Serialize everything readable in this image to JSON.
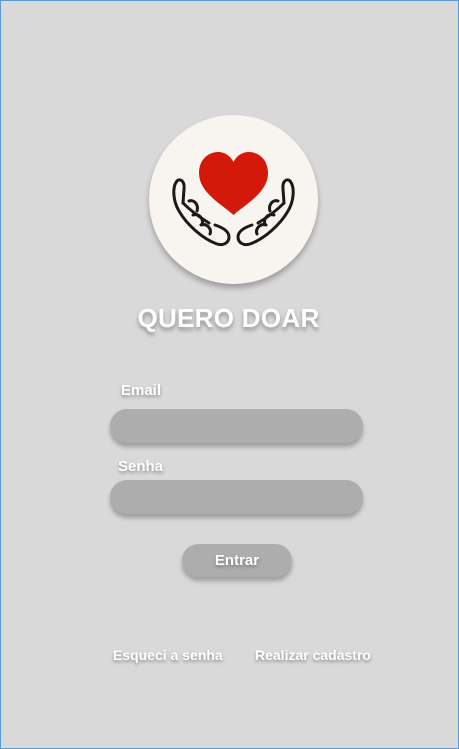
{
  "app": {
    "title": "QUERO DOAR",
    "logo_icon": "heart-in-hands-icon",
    "colors": {
      "background": "#d9d9d9",
      "logo_circle": "#f8f5f1",
      "heart": "#d31a0a",
      "field": "#adadad",
      "text": "#ffffff"
    }
  },
  "form": {
    "email_label": "Email",
    "email_value": "",
    "password_label": "Senha",
    "password_value": "",
    "submit_label": "Entrar"
  },
  "links": {
    "forgot_password": "Esqueci a senha",
    "register": "Realizar cadastro"
  }
}
